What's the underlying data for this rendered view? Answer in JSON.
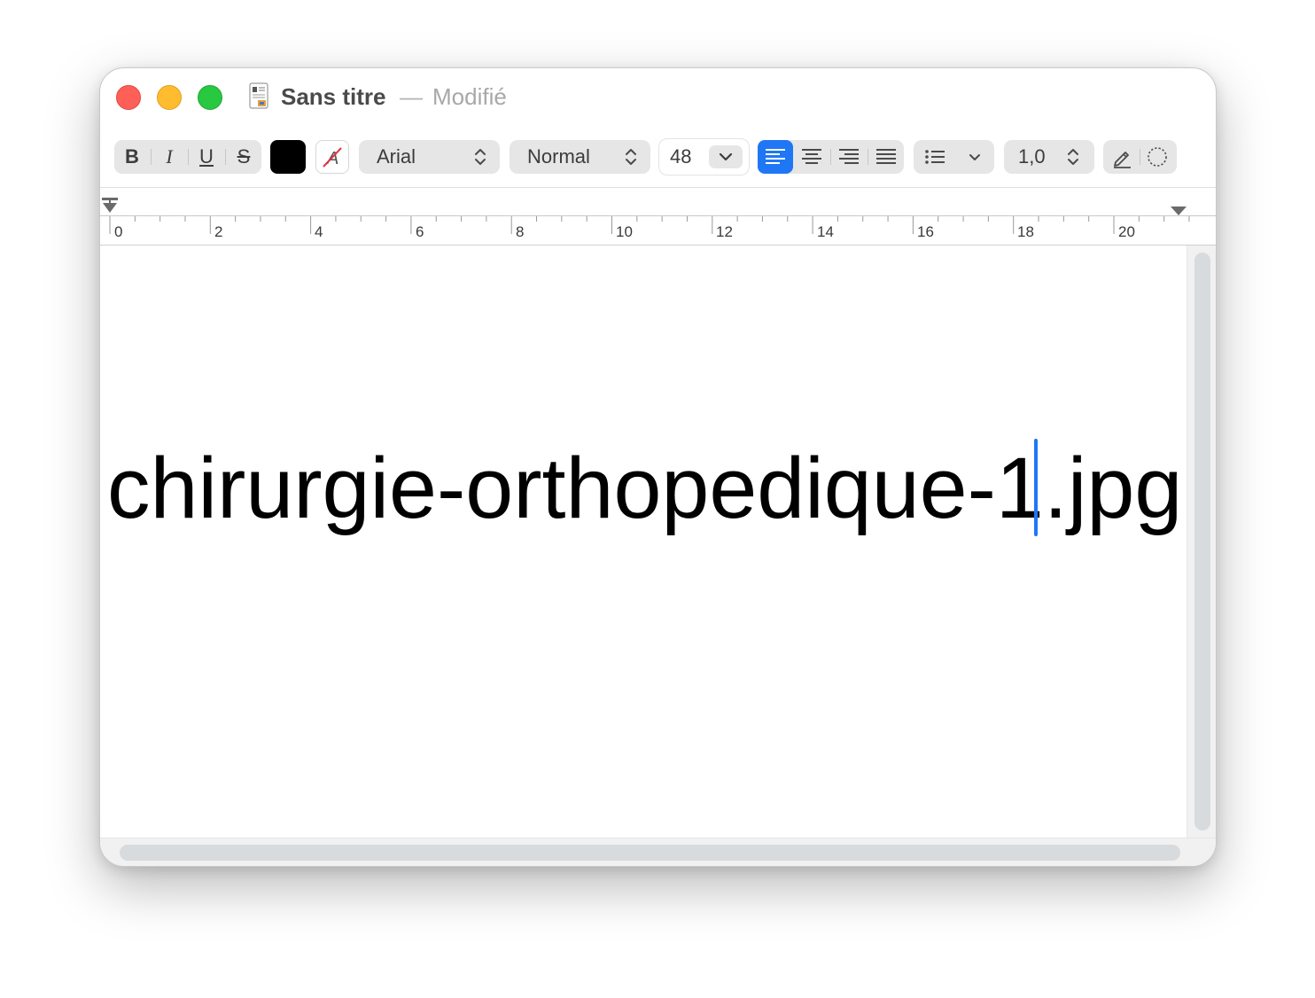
{
  "window": {
    "title": "Sans titre",
    "separator": "—",
    "status": "Modifié"
  },
  "toolbar": {
    "bold_label": "B",
    "italic_label": "I",
    "underline_label": "U",
    "strike_label": "S",
    "text_color": "#000000",
    "font_family": "Arial",
    "font_style": "Normal",
    "font_size": "48",
    "line_spacing": "1,0",
    "alignment_selected": "left",
    "accent_color": "#1f77f5"
  },
  "ruler": {
    "numbers": [
      "0",
      "2",
      "4",
      "6",
      "8",
      "10",
      "12",
      "14",
      "16",
      "18",
      "20"
    ]
  },
  "document": {
    "text_before_caret": "chirurgie-orthopedique-1",
    "text_after_caret": ".jpg"
  }
}
